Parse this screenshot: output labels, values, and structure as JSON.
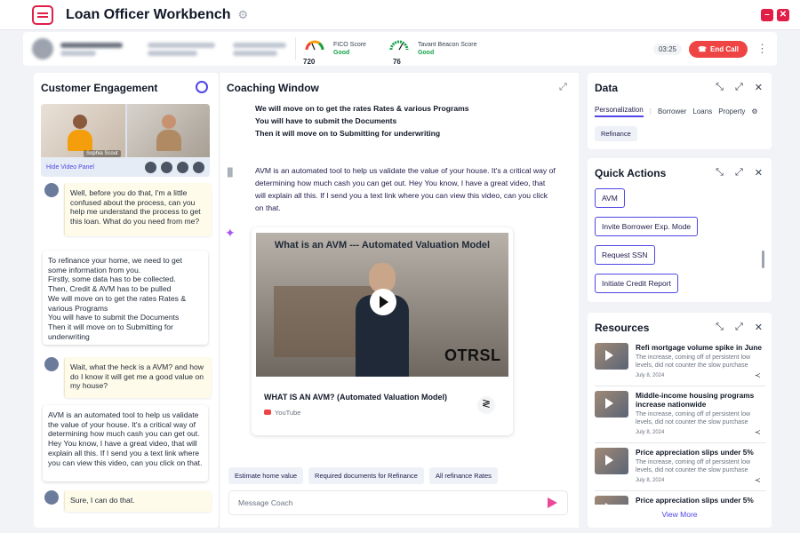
{
  "app": {
    "title": "Loan Officer Workbench"
  },
  "call": {
    "fico_label": "FICO Score",
    "fico_value": "720",
    "fico_status": "Good",
    "beacon_label": "Tavant Beacon Score",
    "beacon_value": "76",
    "beacon_status": "Good",
    "timer": "03:25",
    "end_call_label": "End Call"
  },
  "customer_engagement": {
    "title": "Customer Engagement",
    "video_name": "Sophia Scout",
    "hide_video_label": "Hide Video Panel",
    "messages": [
      "Well, before you do that, I'm a little confused about the process, can you help me understand the process to get this loan.  What do you need from me?",
      "To refinance your home, we need to get some information from you.\nFirstly, some data has to be collected.\nThen, Credit & AVM has to be pulled\nWe will move on to get the rates Rates & various Programs\nYou will have to submit the Documents\nThen it will move on to Submitting  for underwriting",
      "Wait, what the heck is a AVM?  and how do I know it will get me a good value on my house?",
      "AVM is an automated tool to help us validate the value of your house. It's a critical way of determining how much cash you can get out. Hey You know, I have a great video, that will explain all this. If I send you a text link where you can view this video, can you click on that.",
      "Sure, I can do that."
    ]
  },
  "coaching": {
    "title": "Coaching Window",
    "lines": [
      "We will move on to get the rates Rates & various Programs",
      "You will have to submit the Documents",
      "Then it will move on to Submitting  for underwriting"
    ],
    "avm_text": "AVM is an automated tool to help us validate the value of your house. It's a critical way of determining how much cash you can get out. Hey You know, I have a great video, that will explain all this. If I send you a text link where you can view this video, can you click on that.",
    "video_heading": "What is an AVM --- Automated Valuation Model",
    "video_watermark": "OTRSL",
    "video_caption": "WHAT IS AN AVM? (Automated Valuation Model)",
    "video_source": "YouTube",
    "chips": [
      "Estimate home value",
      "Required documents for Refinance",
      "All refinance Rates"
    ],
    "input_placeholder": "Message Coach"
  },
  "data_panel": {
    "title": "Data",
    "tabs": [
      "Personalization",
      "Borrower",
      "Loans",
      "Property"
    ],
    "chip": "Refinance"
  },
  "quick_actions": {
    "title": "Quick Actions",
    "buttons": [
      "AVM",
      "Invite Borrower Exp. Mode",
      "Request SSN",
      "Initiate Credit Report"
    ]
  },
  "resources": {
    "title": "Resources",
    "items": [
      {
        "title": "Refi mortgage volume spike in June",
        "desc": "The increase, coming off of persistent low levels, did not counter the slow purchase",
        "date": "July 8, 2024"
      },
      {
        "title": "Middle-income housing programs increase nationwide",
        "desc": "The increase, coming off of persistent low levels, did not counter the slow purchase",
        "date": "July 8, 2024"
      },
      {
        "title": "Price appreciation slips under 5%",
        "desc": "The increase, coming off of persistent low levels, did not counter the slow purchase",
        "date": "July 8, 2024"
      },
      {
        "title": "Price appreciation slips under 5%",
        "desc": "",
        "date": ""
      }
    ],
    "view_more": "View More"
  }
}
